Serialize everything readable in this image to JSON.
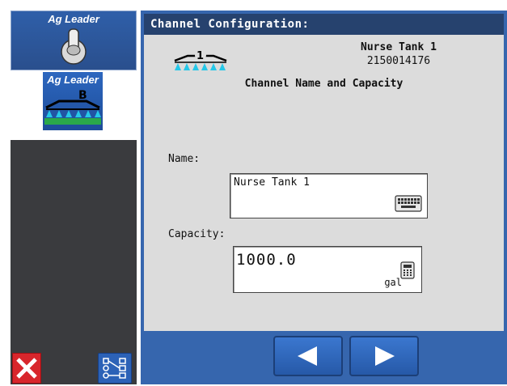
{
  "sidebar": {
    "tiles": [
      {
        "brand": "Ag Leader",
        "icon": "toggle-switch-icon"
      },
      {
        "brand": "Ag Leader",
        "letter": "B",
        "icon": "boom-sprayer-icon"
      }
    ],
    "bottom": {
      "close_icon": "close-icon",
      "tree_icon": "hierarchy-icon"
    }
  },
  "main": {
    "title": "Channel Configuration:",
    "channel": {
      "icon": "boom-channel-icon",
      "number": "1",
      "name": "Nurse Tank 1",
      "serial": "2150014176"
    },
    "section_heading": "Channel Name and Capacity",
    "name_label": "Name:",
    "name_value": "Nurse Tank 1",
    "keyboard_icon": "keyboard-icon",
    "capacity_label": "Capacity:",
    "capacity_value": "1000.0",
    "capacity_unit": "gal",
    "calculator_icon": "calculator-icon"
  },
  "nav": {
    "prev_icon": "arrow-left-icon",
    "next_icon": "arrow-right-icon"
  },
  "colors": {
    "panel_blue": "#3666ae",
    "title_bar": "#26426e",
    "content_gray": "#dcdcdc",
    "close_red": "#d8262c",
    "spray_cyan": "#26c7e8",
    "grass_green": "#2aa84a"
  }
}
